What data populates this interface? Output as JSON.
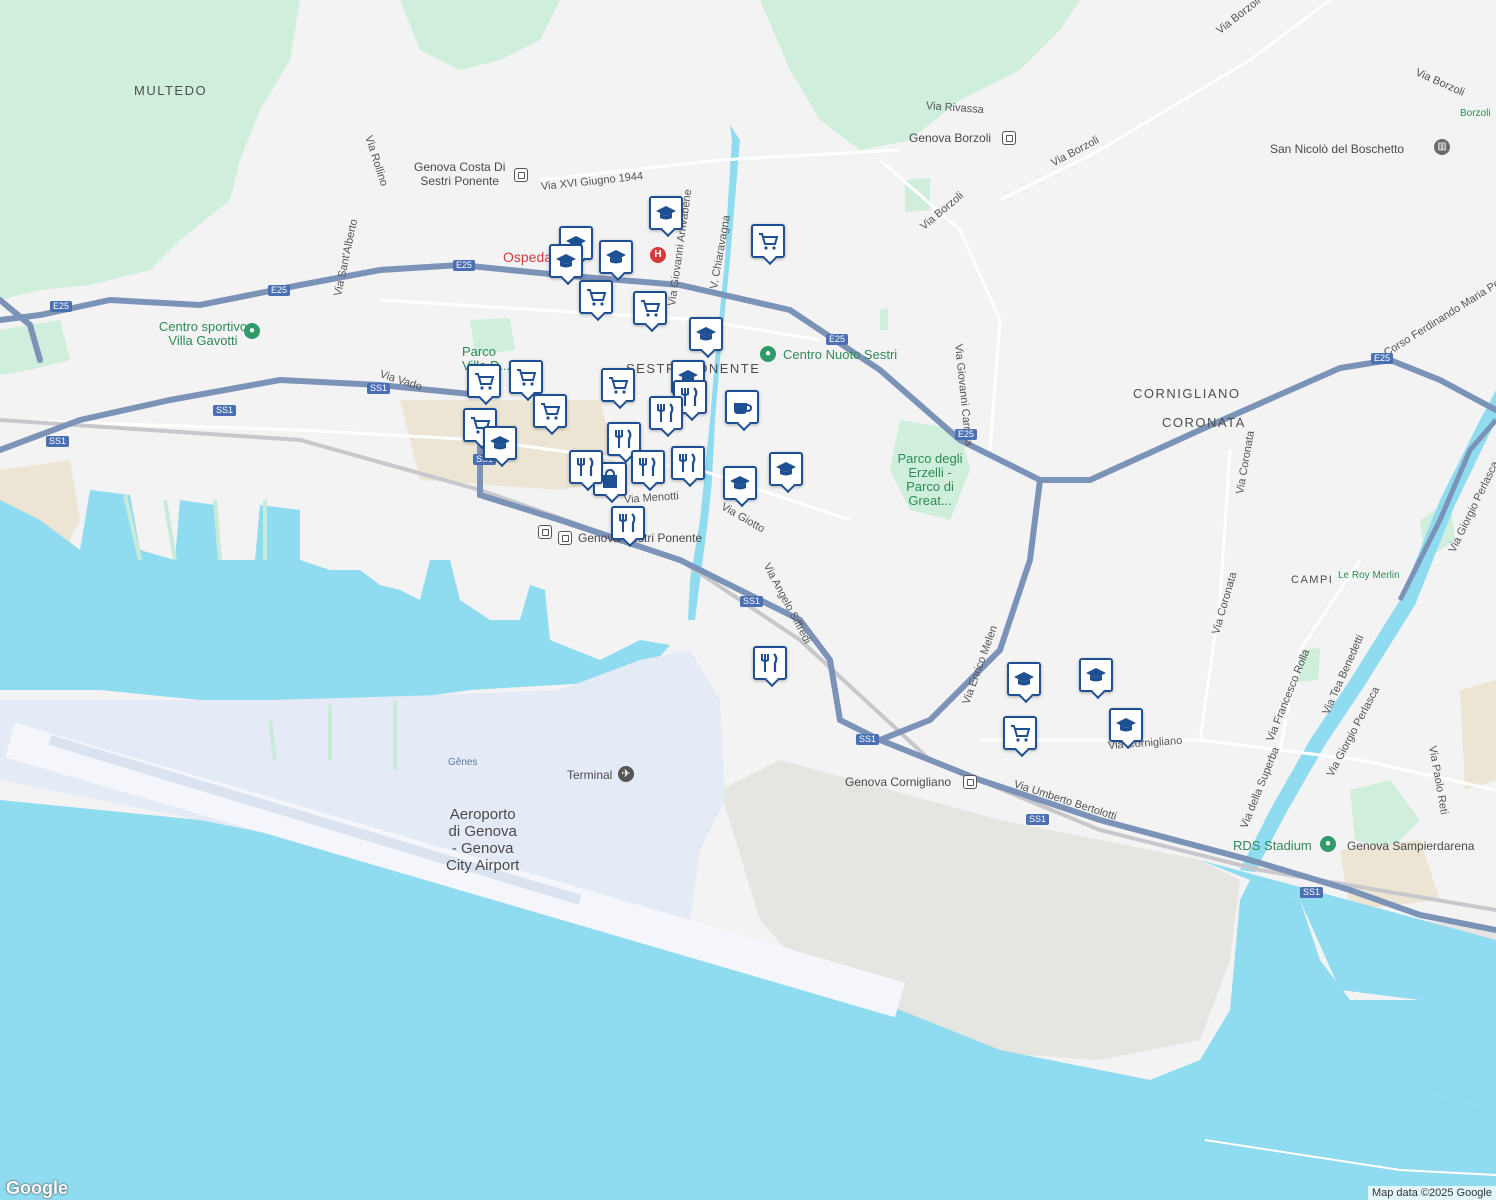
{
  "areas": {
    "multedo": "MULTEDO",
    "sestri": "SESTRI PONENTE",
    "cornigliano": "CORNIGLIANO",
    "coronata": "CORONATA",
    "campi": "CAMPI"
  },
  "roads": {
    "via_rollino": "Via Rollino",
    "via_sant_alberto": "Via Sant'Alberto",
    "via_vado": "Via Vado",
    "via_xvi_giugno": "Via XVI Giugno 1944",
    "via_giovanni_arrivabene": "Via Giovanni Arrivabene",
    "v_chiaravagna": "V. Chiaravagna",
    "via_rivassa": "Via Rivassa",
    "via_borzoli_1": "Via Borzoli",
    "via_borzoli_2": "Via Borzoli",
    "via_borzoli_3": "Via Borzoli",
    "via_borzoli_4": "Via Borzoli",
    "via_giovanni_carrera": "Via Giovanni Carrera",
    "corso_perrone": "Corso Ferdinando Maria Perrone",
    "via_coronata_1": "Via Coronata",
    "via_coronata_2": "Via Coronata",
    "via_giorgio_perlasca_1": "Via Giorgio Perlasca",
    "via_giorgio_perlasca_2": "Via Giorgio Perlasca",
    "via_enrico_melen": "Via Enrico Melen",
    "via_angelo_siffredi": "Via Angelo Siffredi",
    "via_giotto": "Via Giotto",
    "via_menotti": "Via Menotti",
    "via_cornigliano": "Via Cornigliano",
    "via_umberto_bertolotti": "Via Umberto Bertolotti",
    "via_francesco_rolla": "Via Francesco Rolla",
    "via_tea_benedetti": "Via Tea Benedetti",
    "via_della_superba": "Via della Superba",
    "via_paolo_reti": "Via Paolo Reti"
  },
  "places": {
    "centro_sportivo": "Centro sportivo\nVilla Gavotti",
    "parco_villa": "Parco\nVilla D...",
    "centro_nuoto": "Centro Nuoto Sestri",
    "parco_erzelli": "Parco degli\nErzelli -\nParco di\nGreat...",
    "ospedale": "Ospedale",
    "genova_costa": "Genova Costa Di\nSestri Ponente",
    "genova_borzoli": "Genova Borzoli",
    "san_nicolo": "San Nicolò del Boschetto",
    "borzoli_small": "Borzoli",
    "genova_sestri_ponente": "Genova Sestri Ponente",
    "genova_cornigliano": "Genova Cornigliano",
    "genova_sampierdarena": "Genova Sampierdarena",
    "rds_stadium": "RDS Stadium",
    "le_roy_merlin": "Le Roy Merlin",
    "airport": "Aeroporto\ndi Genova\n- Genova\nCity Airport",
    "terminal": "Terminal",
    "genes": "Gênes"
  },
  "shields": {
    "e25_a": "E25",
    "e25_b": "E25",
    "e25_c": "E25",
    "e25_d": "E25",
    "e25_e": "E25",
    "e25_f": "E25",
    "ss1_a": "SS1",
    "ss1_b": "SS1",
    "ss1_c": "SS1",
    "ss1_d": "SS1",
    "ss1_e": "SS1",
    "ss1_f": "SS1",
    "ss1_g": "SS1",
    "ss1_h": "SS1"
  },
  "pins": [
    {
      "type": "school"
    },
    {
      "type": "school"
    },
    {
      "type": "school"
    },
    {
      "type": "school"
    },
    {
      "type": "cart"
    },
    {
      "type": "cart"
    },
    {
      "type": "cart"
    },
    {
      "type": "school"
    },
    {
      "type": "cart"
    },
    {
      "type": "cart"
    },
    {
      "type": "cart"
    },
    {
      "type": "cart"
    },
    {
      "type": "cart"
    },
    {
      "type": "school"
    },
    {
      "type": "restaurant"
    },
    {
      "type": "cafe"
    },
    {
      "type": "restaurant"
    },
    {
      "type": "restaurant"
    },
    {
      "type": "shopping"
    },
    {
      "type": "restaurant"
    },
    {
      "type": "school"
    },
    {
      "type": "school"
    },
    {
      "type": "school"
    },
    {
      "type": "restaurant"
    },
    {
      "type": "restaurant"
    },
    {
      "type": "restaurant"
    },
    {
      "type": "school"
    },
    {
      "type": "school"
    },
    {
      "type": "cart"
    },
    {
      "type": "school"
    },
    {
      "type": "restaurant"
    }
  ],
  "icons": {
    "school": "school-icon",
    "cart": "shopping-cart-icon",
    "restaurant": "restaurant-icon",
    "cafe": "cafe-icon",
    "shopping": "shopping-bag-icon",
    "hospital": "hospital-icon",
    "rail": "rail-station-icon",
    "airport": "airplane-icon",
    "park": "park-icon",
    "landmark": "landmark-icon"
  },
  "colors": {
    "water": "#8fdbef",
    "land": "#f3f3f4",
    "green": "#ccefd6",
    "highway": "#7c93b8",
    "pin_border": "#1f4f93"
  },
  "attribution": "Map data ©2025 Google",
  "logo": "Google"
}
